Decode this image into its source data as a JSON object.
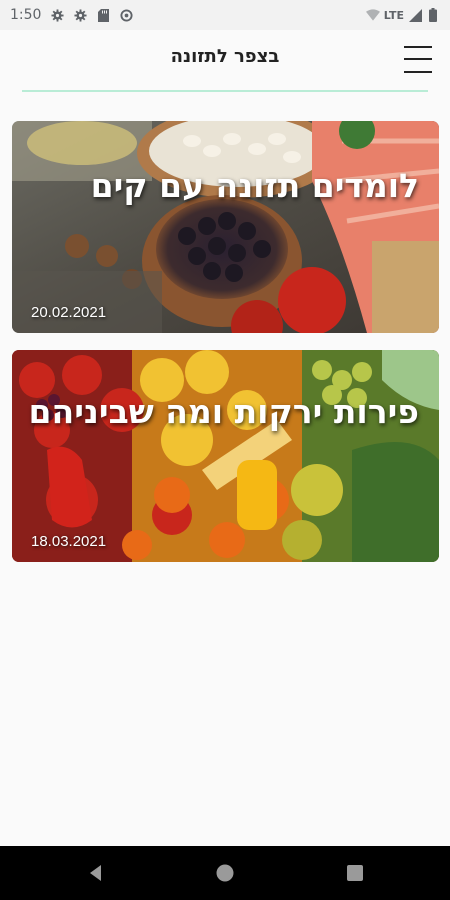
{
  "status_bar": {
    "time": "1:50",
    "network": "LTE",
    "icons": [
      "settings-icon",
      "settings-icon",
      "sd-card-icon",
      "sync-icon",
      "wifi-icon",
      "signal-icon",
      "battery-icon"
    ]
  },
  "header": {
    "title": "בצפר לתזונה",
    "menu_icon": "hamburger-menu-icon",
    "divider_color": "#b9ecd6"
  },
  "articles": [
    {
      "title": "לומדים תזונה עם קים",
      "date": "20.02.2021",
      "image": "healthy-food-photo"
    },
    {
      "title": "פירות ירקות ומה שביניהם",
      "date": "18.03.2021",
      "image": "fruits-vegetables-photo"
    }
  ],
  "nav_bar": {
    "buttons": [
      "back-icon",
      "home-icon",
      "recents-icon"
    ]
  }
}
